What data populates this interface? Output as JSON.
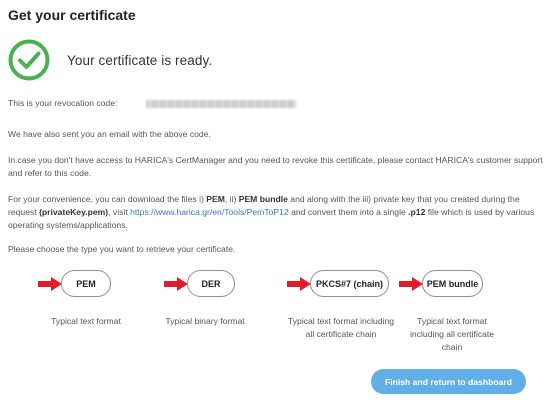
{
  "page": {
    "title": "Get your certificate",
    "ready_message": "Your certificate is ready.",
    "revocation_label": "This is your revocation code:",
    "email_notice": "We have also sent you an email with the above code.",
    "contact_notice": "In case you don't have access to HARICA's CertManager and you need to revoke this certificate, please contact HARICA's customer support and refer to this code.",
    "convenience": {
      "t1": "For your convenience, you can download the files i) ",
      "b1": "PEM",
      "t2": ", ii) ",
      "b2": "PEM bundle",
      "t3": " and along with the iii) private key that you created during the request ",
      "b3": "(privateKey.pem)",
      "t4": ", visit ",
      "link": "https://www.harica.gr/en/Tools/PemToP12",
      "t5": " and convert them into a single ",
      "b4": ".p12",
      "t6": " file which is used by various operating systems/applications."
    },
    "choose_prompt": "Please choose the type you want to retrieve your certificate."
  },
  "formats": [
    {
      "label": "PEM",
      "description": "Typical text format"
    },
    {
      "label": "DER",
      "description": "Typical binary format"
    },
    {
      "label": "PKCS#7 (chain)",
      "description": "Typical text format including all certificate chain"
    },
    {
      "label": "PEM bundle",
      "description": "Typical text format including all certificate chain"
    }
  ],
  "actions": {
    "finish_label": "Finish and return to dashboard"
  },
  "colors": {
    "success_green": "#4caf50",
    "arrow_red": "#e01b2a",
    "primary_button": "#62aee6",
    "link": "#3377b6"
  },
  "icons": {
    "success": "check-circle-icon",
    "pointer": "arrow-right-icon"
  }
}
